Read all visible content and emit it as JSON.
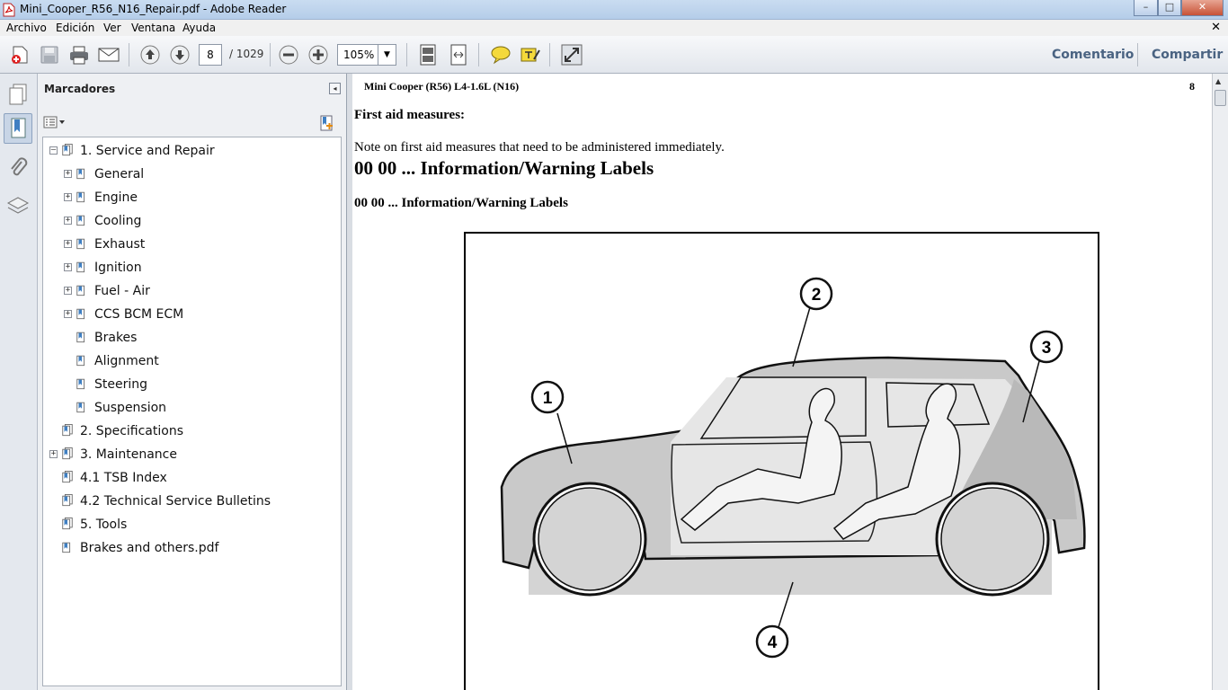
{
  "window": {
    "title": "Mini_Cooper_R56_N16_Repair.pdf - Adobe Reader",
    "minimize": "–",
    "maximize": "□",
    "close": "✕"
  },
  "menu": {
    "items": [
      "Archivo",
      "Edición",
      "Ver",
      "Ventana",
      "Ayuda"
    ],
    "doc_close": "✕"
  },
  "toolbar": {
    "page_current": "8",
    "page_total": "/ 1029",
    "zoom": "105%",
    "zoom_arrow": "▼",
    "comment_label": "Comentario",
    "share_label": "Compartir"
  },
  "bookmarks": {
    "title": "Marcadores",
    "collapse": "◂",
    "items": [
      {
        "label": "1. Service and Repair",
        "expander": "–"
      },
      {
        "label": "General",
        "expander": "+"
      },
      {
        "label": "Engine",
        "expander": "+"
      },
      {
        "label": "Cooling",
        "expander": "+"
      },
      {
        "label": "Exhaust",
        "expander": "+"
      },
      {
        "label": "Ignition",
        "expander": "+"
      },
      {
        "label": "Fuel - Air",
        "expander": "+"
      },
      {
        "label": "CCS BCM ECM",
        "expander": "+"
      },
      {
        "label": "Brakes",
        "expander": ""
      },
      {
        "label": "Alignment",
        "expander": ""
      },
      {
        "label": "Steering",
        "expander": ""
      },
      {
        "label": "Suspension",
        "expander": ""
      },
      {
        "label": "2. Specifications",
        "expander": ""
      },
      {
        "label": "3. Maintenance",
        "expander": "+"
      },
      {
        "label": "4.1 TSB Index",
        "expander": ""
      },
      {
        "label": "4.2 Technical Service Bulletins",
        "expander": ""
      },
      {
        "label": "5. Tools",
        "expander": ""
      },
      {
        "label": "Brakes and others.pdf",
        "expander": ""
      }
    ]
  },
  "document": {
    "header": "Mini Cooper (R56) L4-1.6L (N16)",
    "page_number": "8",
    "first_aid_heading": "First aid measures:",
    "note": "Note on first aid measures that need to be administered immediately.",
    "main_heading": "00 00 ... Information/Warning Labels",
    "sub_heading": "00 00 ... Information/Warning Labels",
    "callouts": [
      "1",
      "2",
      "3",
      "4"
    ]
  },
  "colors": {
    "accent_link": "#4a6382",
    "panel_bg": "#eef0f3"
  }
}
